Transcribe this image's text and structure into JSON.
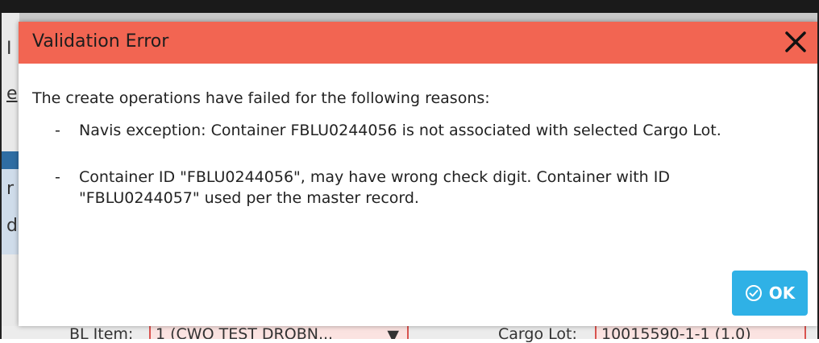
{
  "background": {
    "fields": {
      "bl_item_label": "BL Item:",
      "bl_item_value": "1 (CWO TEST DROBN...",
      "cargo_lot_label": "Cargo Lot:",
      "cargo_lot_value": "10015590-1-1 (1.0)"
    },
    "partial_letters": [
      "I",
      "e",
      "r",
      "d"
    ]
  },
  "dialog": {
    "title": "Validation Error",
    "intro": "The create operations have failed for the following reasons:",
    "reasons": [
      {
        "dash": "-",
        "text": "Navis exception: Container FBLU0244056 is not associated with selected Cargo Lot."
      },
      {
        "dash": "-",
        "text": "Container ID \"FBLU0244056\", may have wrong check digit. Container with ID \"FBLU0244057\" used per the master record."
      }
    ],
    "ok_label": "OK",
    "close_icon": "close-icon",
    "ok_icon": "check-circle-icon",
    "header_color": "#f26552",
    "ok_color": "#2fb1e6"
  }
}
